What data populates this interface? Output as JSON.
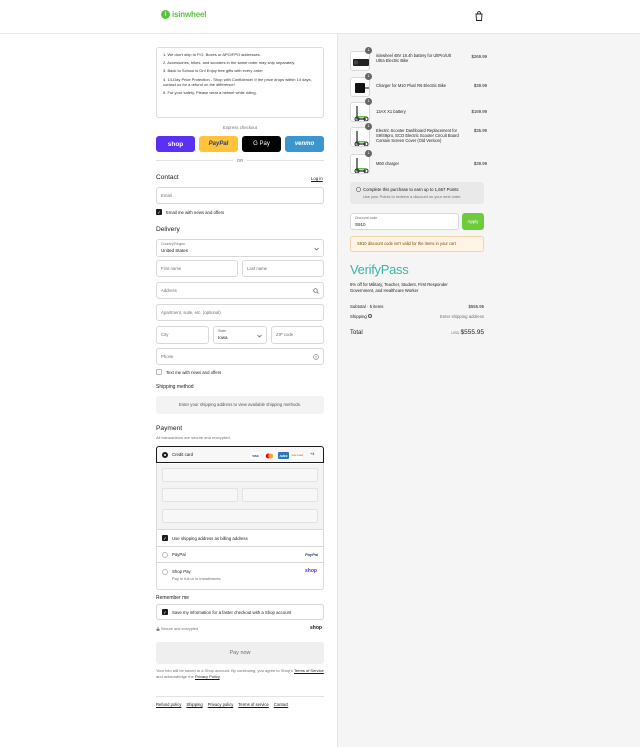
{
  "header": {
    "brand": "isinwheel",
    "logo_glyph": "i",
    "cart_icon": "shopping-bag-icon",
    "accent": "#58c43b"
  },
  "notice": {
    "items": [
      "1.  We don't ship to P.O. Boxes or APO/FPO addresses.",
      "2.  Accessories, bikes, and scooters in the same order may ship separately.",
      "3.  Back to School is On! Enjoy free gifts with every order",
      "4.  14-Day Price Protection - Shop with Confidence! If the price drops within 14 days, contact us for a refund on the difference!",
      "5.  For your safety, Please wear a helmet while riding."
    ]
  },
  "express": {
    "label": "Express checkout",
    "shop": "shop",
    "paypal": "PayPal",
    "gpay": "G Pay",
    "venmo": "venmo",
    "or": "OR"
  },
  "contact": {
    "heading": "Contact",
    "login": "Log in",
    "email_placeholder": "Email",
    "email_news": "Email me with news and offers"
  },
  "delivery": {
    "heading": "Delivery",
    "country_label": "Country/Region",
    "country_value": "United States",
    "first_name": "First name",
    "last_name": "Last name",
    "address": "Address",
    "apartment": "Apartment, suite, etc. (optional)",
    "city": "City",
    "state_label": "State",
    "state_value": "Iowa",
    "zip": "ZIP code",
    "phone": "Phone",
    "text_news": "Text me with news and offers"
  },
  "shipping": {
    "heading": "Shipping method",
    "message": "Enter your shipping address to view available shipping methods."
  },
  "payment": {
    "heading": "Payment",
    "subtitle": "All transactions are secure and encrypted.",
    "credit_card": "Credit card",
    "card_icons": {
      "visa": "VISA",
      "mc": "MC",
      "amex": "AMEX",
      "discover": "DISCOVER",
      "more": "+4"
    },
    "billing_same": "Use shipping address as billing address",
    "paypal": "PayPal",
    "paypal_logo": "PayPal",
    "shoppay": "Shop Pay",
    "shoppay_sub": "Pay in full or in installments",
    "shoppay_logo": "shop"
  },
  "remember": {
    "heading": "Remember me",
    "save_info": "Save my information for a faster checkout with a Shop account",
    "secure": "Secure and encrypted",
    "shop_logo": "shop"
  },
  "pay_now": "Pay now",
  "legal": {
    "line1": "Your info will be saved to a Shop account. By continuing, you agree to Shop's",
    "tos": "Terms of Service",
    "mid": "and acknowledge the",
    "privacy": "Privacy Policy",
    "end": "."
  },
  "footer": [
    "Refund policy",
    "Shipping",
    "Privacy policy",
    "Terms of service",
    "Contact"
  ],
  "cart": {
    "items": [
      {
        "qty": "1",
        "name": "isinwheel 48V 18.4h battery for UltPro/Ult Ultra Electric Bike",
        "price": "$269.99"
      },
      {
        "qty": "1",
        "name": "Charger for M10 Plus/ R6 Electric Bike",
        "price": "$39.99"
      },
      {
        "qty": "1",
        "name": "13AX X1 battery",
        "price": "$169.99"
      },
      {
        "qty": "1",
        "name": "Electric Scooter Dashboard Replacement for S9/S9pro, ECO Electric Scooter Circuit Board Contain Screen Cover (Old Version)",
        "price": "$35.99"
      },
      {
        "qty": "1",
        "name": "M60 charger",
        "price": "$39.99"
      }
    ],
    "points_title": "Complete this purchase to earn up to 1,667 Points",
    "points_sub": "Use your Points to redeem a discount on your next order.",
    "discount_label": "Discount code",
    "discount_value": "S910",
    "apply": "Apply",
    "warning": "S910 discount code isn't valid for the items in your cart",
    "verify_logo": "VerifyPass",
    "verify_text": "6% off for Military, Teacher, Student, First Responder Government, and Healthcare Worker",
    "subtotal_label": "Subtotal · 5 items",
    "subtotal_value": "$555.95",
    "shipping_label": "Shipping",
    "shipping_value": "Enter shipping address",
    "total_label": "Total",
    "currency": "USD",
    "total_value": "$555.95"
  }
}
